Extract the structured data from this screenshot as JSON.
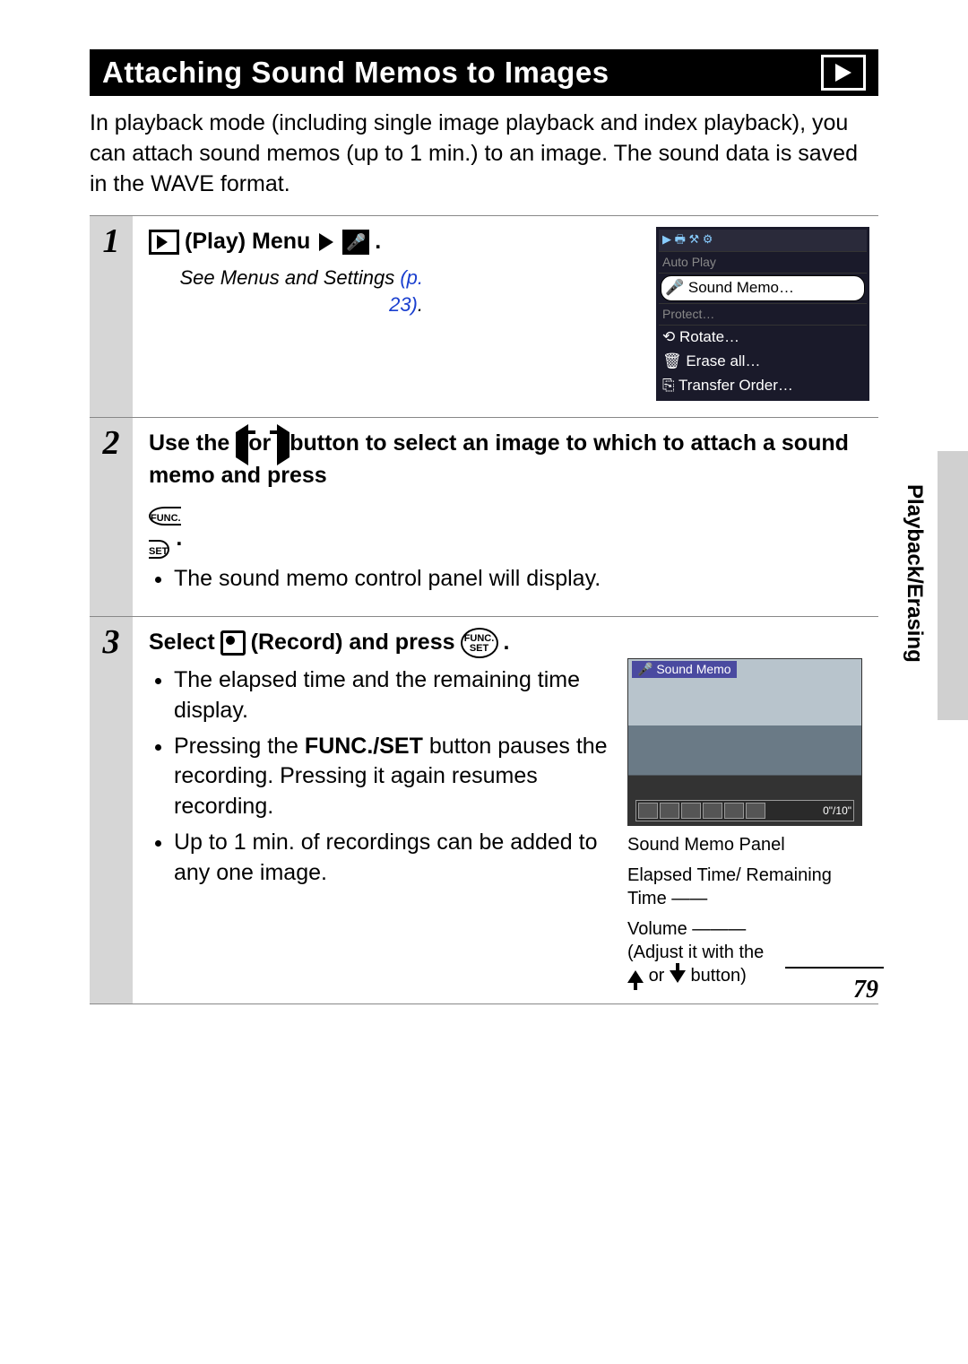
{
  "title": "Attaching Sound Memos to Images",
  "intro": "In playback mode (including single image playback and index playback), you can attach sound memos (up to 1 min.) to an image. The sound data is saved in the WAVE format.",
  "side_label": "Playback/Erasing",
  "page_number": "79",
  "step1": {
    "num": "1",
    "label_a": "(Play) Menu",
    "label_b": ".",
    "see_prefix": "See Menus and Settings ",
    "see_link": "(p. 23)",
    "see_suffix": ".",
    "menu": {
      "tabs": "▶ 🖶 ⚒ ⚙",
      "item_top": "Auto Play",
      "item_sel": "Sound Memo…",
      "item_protect": "Protect…",
      "item_rotate": "Rotate…",
      "item_erase": "Erase all…",
      "item_transfer": "Transfer Order…"
    }
  },
  "step2": {
    "num": "2",
    "text_a": "Use the ",
    "text_b": " or ",
    "text_c": " button to select an image to which to attach a sound memo and press ",
    "text_d": " .",
    "funcset": "FUNC.\nSET",
    "bullet1": "The sound memo control panel will display."
  },
  "step3": {
    "num": "3",
    "head_a": "Select ",
    "head_b": " (Record) and press ",
    "head_c": " .",
    "funcset": "FUNC.\nSET",
    "bullet1": "The elapsed time and the remaining time display.",
    "bullet2a": "Pressing the ",
    "bullet2b": "FUNC./SET",
    "bullet2c": " button pauses the recording. Pressing it again resumes recording.",
    "bullet3": "Up to 1 min. of recordings can be added to any one image.",
    "cam_title": "Sound Memo",
    "cam_time": "0\"/10\"",
    "annot_panel": "Sound Memo Panel",
    "annot_time": "Elapsed Time/ Remaining Time",
    "annot_vol_a": "Volume",
    "annot_vol_b": "(Adjust it with the",
    "annot_vol_c": " or ",
    "annot_vol_d": " button)"
  }
}
